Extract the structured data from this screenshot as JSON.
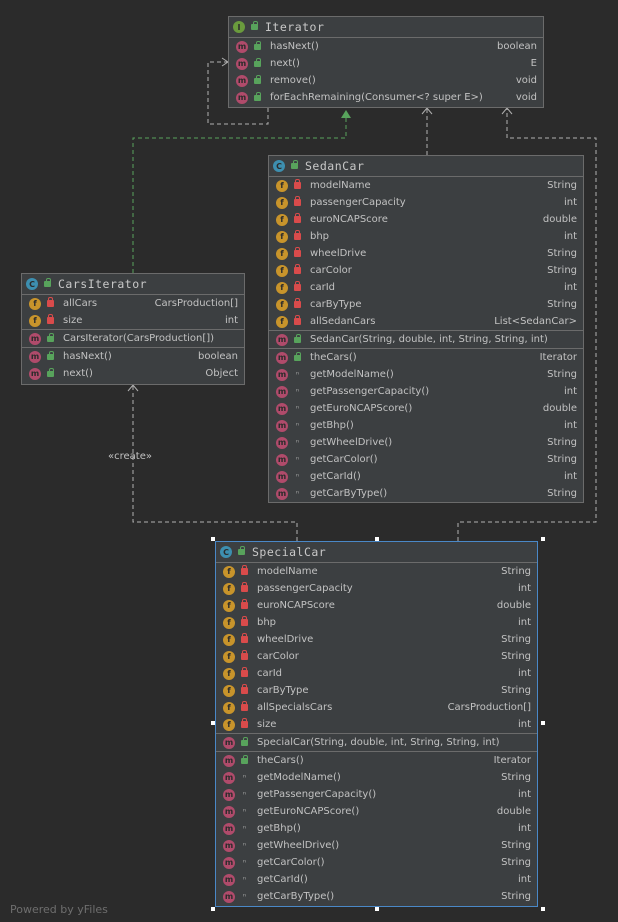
{
  "iterator": {
    "title": "Iterator",
    "methods": [
      {
        "name": "hasNext()",
        "type": "boolean"
      },
      {
        "name": "next()",
        "type": "E"
      },
      {
        "name": "remove()",
        "type": "void"
      },
      {
        "name": "forEachRemaining(Consumer<? super E>)",
        "type": "void"
      }
    ]
  },
  "sedan": {
    "title": "SedanCar",
    "fields": [
      {
        "name": "modelName",
        "type": "String"
      },
      {
        "name": "passengerCapacity",
        "type": "int"
      },
      {
        "name": "euroNCAPScore",
        "type": "double"
      },
      {
        "name": "bhp",
        "type": "int"
      },
      {
        "name": "wheelDrive",
        "type": "String"
      },
      {
        "name": "carColor",
        "type": "String"
      },
      {
        "name": "carId",
        "type": "int"
      },
      {
        "name": "carByType",
        "type": "String"
      },
      {
        "name": "allSedanCars",
        "type": "List<SedanCar>"
      }
    ],
    "constructor": {
      "name": "SedanCar(String, double, int, String, String, int)",
      "type": ""
    },
    "methods": [
      {
        "name": "theCars()",
        "type": "Iterator"
      },
      {
        "name": "getModelName()",
        "type": "String"
      },
      {
        "name": "getPassengerCapacity()",
        "type": "int"
      },
      {
        "name": "getEuroNCAPScore()",
        "type": "double"
      },
      {
        "name": "getBhp()",
        "type": "int"
      },
      {
        "name": "getWheelDrive()",
        "type": "String"
      },
      {
        "name": "getCarColor()",
        "type": "String"
      },
      {
        "name": "getCarId()",
        "type": "int"
      },
      {
        "name": "getCarByType()",
        "type": "String"
      }
    ]
  },
  "carsIterator": {
    "title": "CarsIterator",
    "fields": [
      {
        "name": "allCars",
        "type": "CarsProduction[]"
      },
      {
        "name": "size",
        "type": "int"
      }
    ],
    "constructor": {
      "name": "CarsIterator(CarsProduction[])",
      "type": ""
    },
    "methods": [
      {
        "name": "hasNext()",
        "type": "boolean"
      },
      {
        "name": "next()",
        "type": "Object"
      }
    ]
  },
  "special": {
    "title": "SpecialCar",
    "fields": [
      {
        "name": "modelName",
        "type": "String"
      },
      {
        "name": "passengerCapacity",
        "type": "int"
      },
      {
        "name": "euroNCAPScore",
        "type": "double"
      },
      {
        "name": "bhp",
        "type": "int"
      },
      {
        "name": "wheelDrive",
        "type": "String"
      },
      {
        "name": "carColor",
        "type": "String"
      },
      {
        "name": "carId",
        "type": "int"
      },
      {
        "name": "carByType",
        "type": "String"
      },
      {
        "name": "allSpecialsCars",
        "type": "CarsProduction[]"
      },
      {
        "name": "size",
        "type": "int"
      }
    ],
    "constructor": {
      "name": "SpecialCar(String, double, int, String, String, int)",
      "type": ""
    },
    "methods": [
      {
        "name": "theCars()",
        "type": "Iterator"
      },
      {
        "name": "getModelName()",
        "type": "String"
      },
      {
        "name": "getPassengerCapacity()",
        "type": "int"
      },
      {
        "name": "getEuroNCAPScore()",
        "type": "double"
      },
      {
        "name": "getBhp()",
        "type": "int"
      },
      {
        "name": "getWheelDrive()",
        "type": "String"
      },
      {
        "name": "getCarColor()",
        "type": "String"
      },
      {
        "name": "getCarId()",
        "type": "int"
      },
      {
        "name": "getCarByType()",
        "type": "String"
      }
    ]
  },
  "edge_label_create": "«create»",
  "footer": "Powered by yFiles",
  "colors": {
    "background": "#2b2b2b",
    "node_fill": "#3c3f41",
    "edge": "#9a9a9a",
    "implements_edge": "#58a35c",
    "selection": "#4a88c7"
  }
}
